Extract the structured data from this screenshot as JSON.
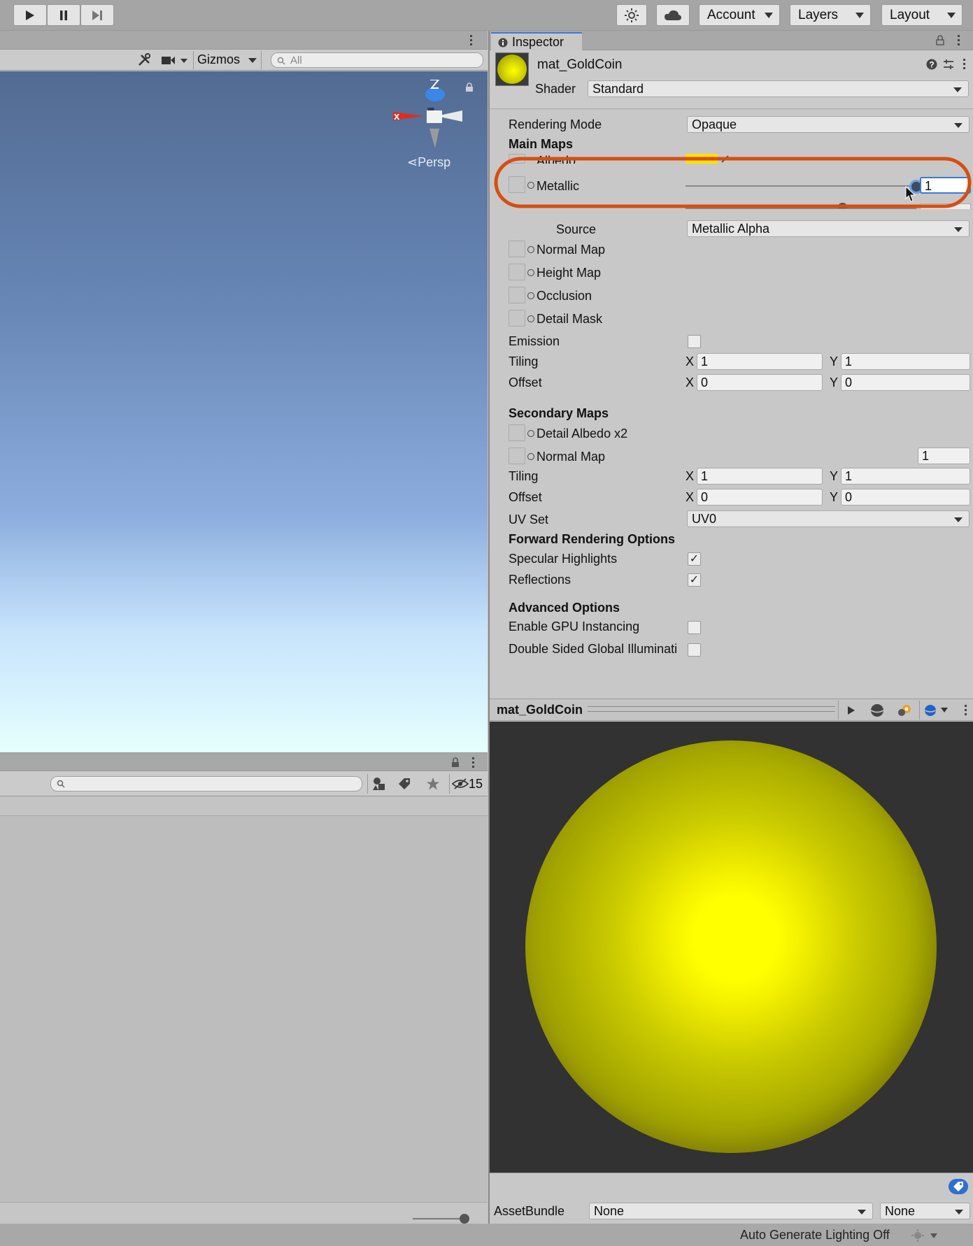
{
  "toolbar": {
    "play_icon": "play-icon",
    "pause_icon": "pause-icon",
    "step_icon": "step-icon",
    "account": "Account",
    "layers": "Layers",
    "layout": "Layout"
  },
  "scene": {
    "gizmos": "Gizmos",
    "search_placeholder": "All",
    "axis_x": "x",
    "axis_z": "z",
    "persp": "Persp"
  },
  "project": {
    "hidden_count": "15"
  },
  "inspector": {
    "tab": "Inspector",
    "material_name": "mat_GoldCoin",
    "shader_label": "Shader",
    "shader_value": "Standard",
    "rendering_mode_label": "Rendering Mode",
    "rendering_mode_value": "Opaque",
    "main_maps": "Main Maps",
    "albedo": "Albedo",
    "albedo_color": "#ffe100",
    "metallic": "Metallic",
    "metallic_value": "1",
    "metallic_level": 1.0,
    "smoothness_level": 0.68,
    "source_label": "Source",
    "source_value": "Metallic Alpha",
    "normal_map": "Normal Map",
    "height_map": "Height Map",
    "occlusion": "Occlusion",
    "detail_mask": "Detail Mask",
    "emission": "Emission",
    "tiling": "Tiling",
    "offset": "Offset",
    "x": "X",
    "y": "Y",
    "tiling_x": "1",
    "tiling_y": "1",
    "offset_x": "0",
    "offset_y": "0",
    "secondary_maps": "Secondary Maps",
    "detail_albedo": "Detail Albedo x2",
    "normal_map2": "Normal Map",
    "normal_map2_value": "1",
    "tiling2_x": "1",
    "tiling2_y": "1",
    "offset2_x": "0",
    "offset2_y": "0",
    "uv_set_label": "UV Set",
    "uv_set_value": "UV0",
    "forward_rendering": "Forward Rendering Options",
    "specular": "Specular Highlights",
    "specular_checked": "✓",
    "reflections": "Reflections",
    "reflections_checked": "✓",
    "advanced": "Advanced Options",
    "gpu_instancing": "Enable GPU Instancing",
    "double_sided": "Double Sided Global Illuminati",
    "highlight_color": "#d64f0f"
  },
  "preview": {
    "title": "mat_GoldCoin",
    "asset_bundle": "AssetBundle",
    "bundle_value": "None",
    "variant_value": "None"
  },
  "status": {
    "text": "Auto Generate Lighting Off"
  }
}
